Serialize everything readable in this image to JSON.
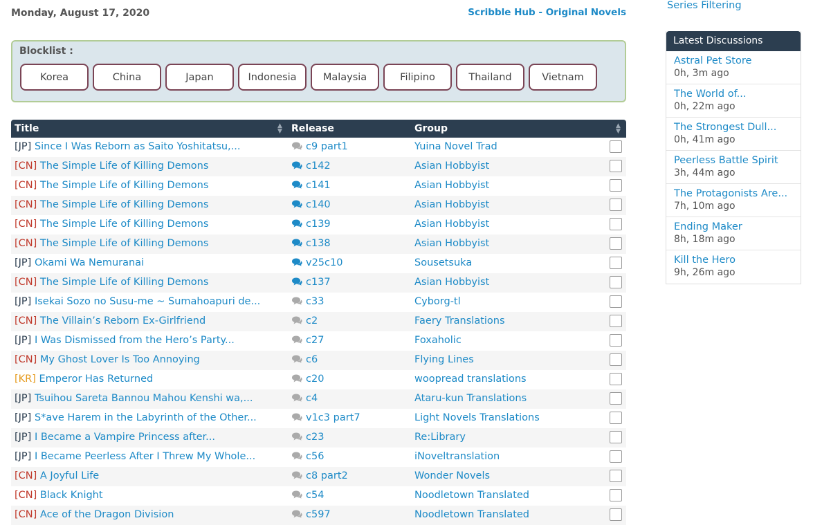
{
  "header": {
    "date": "Monday, August 17, 2020",
    "site_link": "Scribble Hub - Original Novels"
  },
  "blocklist": {
    "label": "Blocklist :",
    "items": [
      "Korea",
      "China",
      "Japan",
      "Indonesia",
      "Malaysia",
      "Filipino",
      "Thailand",
      "Vietnam"
    ]
  },
  "table": {
    "columns": {
      "title": "Title",
      "release": "Release",
      "group": "Group"
    },
    "rows": [
      {
        "tag": "[JP]",
        "title": "Since I Was Reborn as Saito Yoshitatsu,...",
        "release": "c9 part1",
        "group": "Yuina Novel Trad",
        "comment": "gray"
      },
      {
        "tag": "[CN]",
        "title": "The Simple Life of Killing Demons",
        "release": "c142",
        "group": "Asian Hobbyist",
        "comment": "blue"
      },
      {
        "tag": "[CN]",
        "title": "The Simple Life of Killing Demons",
        "release": "c141",
        "group": "Asian Hobbyist",
        "comment": "blue"
      },
      {
        "tag": "[CN]",
        "title": "The Simple Life of Killing Demons",
        "release": "c140",
        "group": "Asian Hobbyist",
        "comment": "blue"
      },
      {
        "tag": "[CN]",
        "title": "The Simple Life of Killing Demons",
        "release": "c139",
        "group": "Asian Hobbyist",
        "comment": "blue"
      },
      {
        "tag": "[CN]",
        "title": "The Simple Life of Killing Demons",
        "release": "c138",
        "group": "Asian Hobbyist",
        "comment": "blue"
      },
      {
        "tag": "[JP]",
        "title": "Okami Wa Nemuranai",
        "release": "v25c10",
        "group": "Sousetsuka",
        "comment": "blue"
      },
      {
        "tag": "[CN]",
        "title": "The Simple Life of Killing Demons",
        "release": "c137",
        "group": "Asian Hobbyist",
        "comment": "blue"
      },
      {
        "tag": "[JP]",
        "title": "Isekai Sozo no Susu-me ~ Sumahoapuri de...",
        "release": "c33",
        "group": "Cyborg-tl",
        "comment": "gray"
      },
      {
        "tag": "[CN]",
        "title": "The Villain’s Reborn Ex-Girlfriend",
        "release": "c2",
        "group": "Faery Translations",
        "comment": "gray"
      },
      {
        "tag": "[JP]",
        "title": "I Was Dismissed from the Hero’s Party...",
        "release": "c27",
        "group": "Foxaholic",
        "comment": "gray"
      },
      {
        "tag": "[CN]",
        "title": "My Ghost Lover Is Too Annoying",
        "release": "c6",
        "group": "Flying Lines",
        "comment": "gray"
      },
      {
        "tag": "[KR]",
        "title": "Emperor Has Returned",
        "release": "c20",
        "group": "woopread translations",
        "comment": "gray"
      },
      {
        "tag": "[JP]",
        "title": "Tsuihou Sareta Bannou Mahou Kenshi wa,...",
        "release": "c4",
        "group": "Ataru-kun Translations",
        "comment": "gray"
      },
      {
        "tag": "[JP]",
        "title": "S*ave Harem in the Labyrinth of the Other...",
        "release": "v1c3 part7",
        "group": "Light Novels Translations",
        "comment": "gray"
      },
      {
        "tag": "[JP]",
        "title": "I Became a Vampire Princess after...",
        "release": "c23",
        "group": "Re:Library",
        "comment": "gray"
      },
      {
        "tag": "[JP]",
        "title": "I Became Peerless After I Threw My Whole...",
        "release": "c56",
        "group": "iNoveltranslation",
        "comment": "gray"
      },
      {
        "tag": "[CN]",
        "title": "A Joyful Life",
        "release": "c8 part2",
        "group": "Wonder Novels",
        "comment": "gray"
      },
      {
        "tag": "[CN]",
        "title": "Black Knight",
        "release": "c54",
        "group": "Noodletown Translated",
        "comment": "gray"
      },
      {
        "tag": "[CN]",
        "title": "Ace of the Dragon Division",
        "release": "c597",
        "group": "Noodletown Translated",
        "comment": "gray"
      }
    ]
  },
  "sidebar": {
    "series_filtering": "Series Filtering",
    "discussions_title": "Latest Discussions",
    "discussions": [
      {
        "title": "Astral Pet Store",
        "time": "0h, 3m ago"
      },
      {
        "title": "The World of...",
        "time": "0h, 22m ago"
      },
      {
        "title": "The Strongest Dull...",
        "time": "0h, 41m ago"
      },
      {
        "title": "Peerless Battle Spirit",
        "time": "3h, 44m ago"
      },
      {
        "title": "The Protagonists Are...",
        "time": "7h, 10m ago"
      },
      {
        "title": "Ending Maker",
        "time": "8h, 18m ago"
      },
      {
        "title": "Kill the Hero",
        "time": "9h, 26m ago"
      }
    ]
  },
  "colors": {
    "accent": "#1d8ac7",
    "header_bg": "#2c3e50",
    "tag_cn": "#c0392b",
    "tag_kr": "#e59a1c",
    "comment_gray": "#aaaaaa"
  }
}
